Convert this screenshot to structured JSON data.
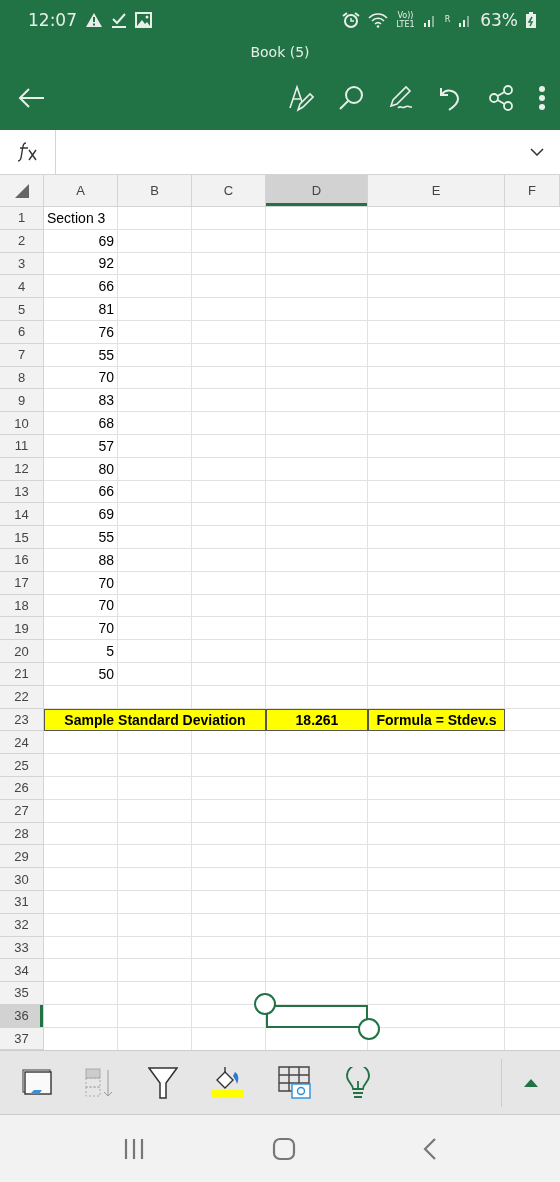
{
  "status_bar": {
    "time": "12:07",
    "volte": "Vo))",
    "network": "LTE1",
    "roaming": "R",
    "battery": "63%"
  },
  "title": "Book (5)",
  "columns": [
    {
      "label": "A",
      "selected": false
    },
    {
      "label": "B",
      "selected": false
    },
    {
      "label": "C",
      "selected": false
    },
    {
      "label": "D",
      "selected": true
    },
    {
      "label": "E",
      "selected": false
    },
    {
      "label": "F",
      "selected": false
    }
  ],
  "rows": [
    {
      "number": "1",
      "selected": false,
      "kind": "plain",
      "cells": [
        {
          "kind": "text",
          "value": "Section 3"
        }
      ]
    },
    {
      "number": "2",
      "selected": false,
      "kind": "plain",
      "cells": [
        {
          "kind": "number",
          "value": "69"
        }
      ]
    },
    {
      "number": "3",
      "selected": false,
      "kind": "plain",
      "cells": [
        {
          "kind": "number",
          "value": "92"
        }
      ]
    },
    {
      "number": "4",
      "selected": false,
      "kind": "plain",
      "cells": [
        {
          "kind": "number",
          "value": "66"
        }
      ]
    },
    {
      "number": "5",
      "selected": false,
      "kind": "plain",
      "cells": [
        {
          "kind": "number",
          "value": "81"
        }
      ]
    },
    {
      "number": "6",
      "selected": false,
      "kind": "plain",
      "cells": [
        {
          "kind": "number",
          "value": "76"
        }
      ]
    },
    {
      "number": "7",
      "selected": false,
      "kind": "plain",
      "cells": [
        {
          "kind": "number",
          "value": "55"
        }
      ]
    },
    {
      "number": "8",
      "selected": false,
      "kind": "plain",
      "cells": [
        {
          "kind": "number",
          "value": "70"
        }
      ]
    },
    {
      "number": "9",
      "selected": false,
      "kind": "plain",
      "cells": [
        {
          "kind": "number",
          "value": "83"
        }
      ]
    },
    {
      "number": "10",
      "selected": false,
      "kind": "plain",
      "cells": [
        {
          "kind": "number",
          "value": "68"
        }
      ]
    },
    {
      "number": "11",
      "selected": false,
      "kind": "plain",
      "cells": [
        {
          "kind": "number",
          "value": "57"
        }
      ]
    },
    {
      "number": "12",
      "selected": false,
      "kind": "plain",
      "cells": [
        {
          "kind": "number",
          "value": "80"
        }
      ]
    },
    {
      "number": "13",
      "selected": false,
      "kind": "plain",
      "cells": [
        {
          "kind": "number",
          "value": "66"
        }
      ]
    },
    {
      "number": "14",
      "selected": false,
      "kind": "plain",
      "cells": [
        {
          "kind": "number",
          "value": "69"
        }
      ]
    },
    {
      "number": "15",
      "selected": false,
      "kind": "plain",
      "cells": [
        {
          "kind": "number",
          "value": "55"
        }
      ]
    },
    {
      "number": "16",
      "selected": false,
      "kind": "plain",
      "cells": [
        {
          "kind": "number",
          "value": "88"
        }
      ]
    },
    {
      "number": "17",
      "selected": false,
      "kind": "plain",
      "cells": [
        {
          "kind": "number",
          "value": "70"
        }
      ]
    },
    {
      "number": "18",
      "selected": false,
      "kind": "plain",
      "cells": [
        {
          "kind": "number",
          "value": "70"
        }
      ]
    },
    {
      "number": "19",
      "selected": false,
      "kind": "plain",
      "cells": [
        {
          "kind": "number",
          "value": "70"
        }
      ]
    },
    {
      "number": "20",
      "selected": false,
      "kind": "plain",
      "cells": [
        {
          "kind": "number",
          "value": "5"
        }
      ]
    },
    {
      "number": "21",
      "selected": false,
      "kind": "plain",
      "cells": [
        {
          "kind": "number",
          "value": "50"
        }
      ]
    },
    {
      "number": "22",
      "selected": false,
      "kind": "plain"
    },
    {
      "number": "23",
      "selected": false,
      "kind": "summary",
      "cells": [
        {
          "kind": "text",
          "value": "Sample Standard Deviation"
        },
        {
          "kind": "text",
          "value": "18.261"
        },
        {
          "kind": "text",
          "value": "Formula = Stdev.s"
        }
      ]
    },
    {
      "number": "24",
      "selected": false,
      "kind": "plain"
    },
    {
      "number": "25",
      "selected": false,
      "kind": "plain"
    },
    {
      "number": "26",
      "selected": false,
      "kind": "plain"
    },
    {
      "number": "27",
      "selected": false,
      "kind": "plain"
    },
    {
      "number": "28",
      "selected": false,
      "kind": "plain"
    },
    {
      "number": "29",
      "selected": false,
      "kind": "plain"
    },
    {
      "number": "30",
      "selected": false,
      "kind": "plain"
    },
    {
      "number": "31",
      "selected": false,
      "kind": "plain"
    },
    {
      "number": "32",
      "selected": false,
      "kind": "plain"
    },
    {
      "number": "33",
      "selected": false,
      "kind": "plain"
    },
    {
      "number": "34",
      "selected": false,
      "kind": "plain"
    },
    {
      "number": "35",
      "selected": false,
      "kind": "plain"
    },
    {
      "number": "36",
      "selected": true,
      "kind": "plain"
    },
    {
      "number": "37",
      "selected": false,
      "kind": "plain"
    }
  ]
}
